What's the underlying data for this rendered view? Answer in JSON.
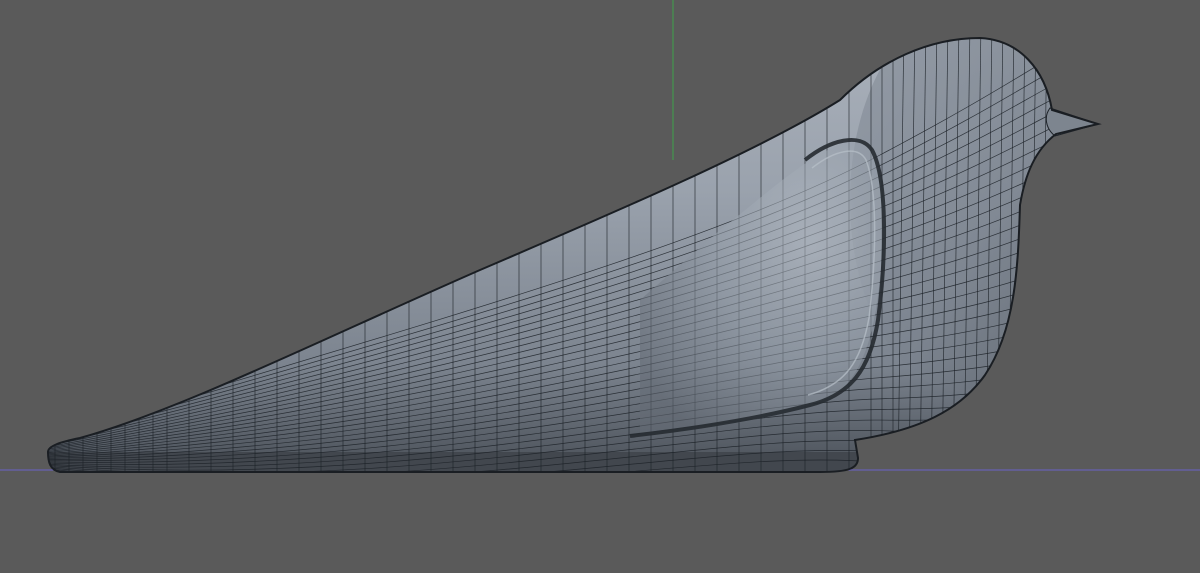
{
  "viewport": {
    "background_color": "#5a5a5a",
    "y_axis_color": "#3fa24a",
    "x_axis_color": "#6a62c8",
    "view": "perspective-side"
  },
  "model": {
    "object": "bird-figurine",
    "display_mode": "wireframe-on-shaded",
    "shade_color": "#8f97a3",
    "wire_color": "#1c2127"
  }
}
